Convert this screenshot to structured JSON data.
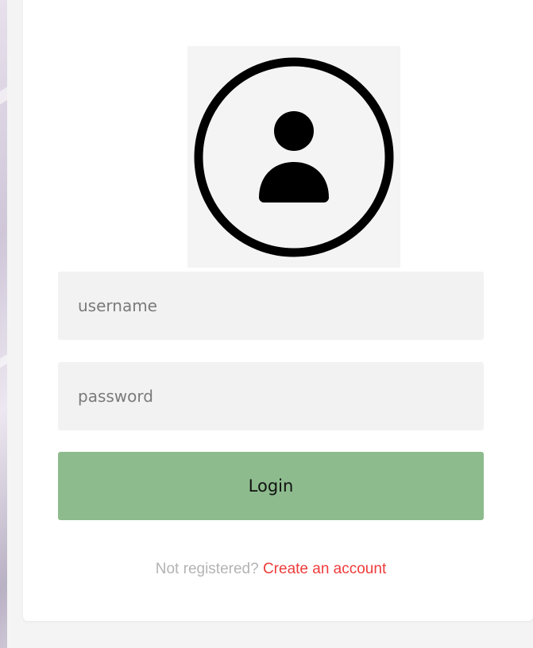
{
  "login_form": {
    "username_placeholder": "username",
    "password_placeholder": "password",
    "login_label": "Login"
  },
  "footer": {
    "prompt": "Not registered?",
    "link_label": "Create an account"
  },
  "colors": {
    "login_button": "#8dbb8d",
    "link": "#ee3b3b",
    "field_background": "#f2f2f2"
  },
  "icons": {
    "avatar": "user-circle-icon"
  }
}
